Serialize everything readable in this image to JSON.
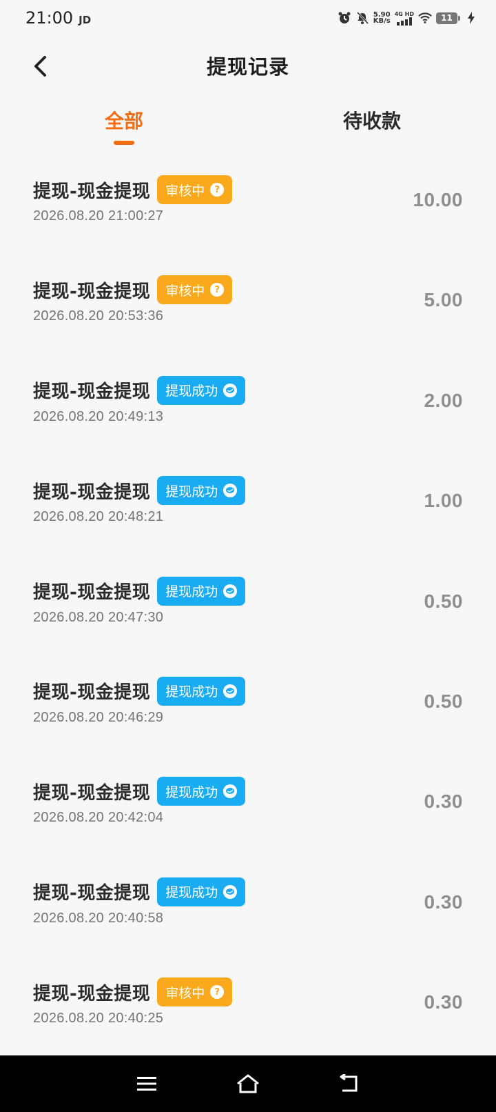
{
  "status_bar": {
    "time": "21:00",
    "carrier": "JD",
    "net_speed_value": "5.90",
    "net_speed_unit": "KB/s",
    "network_label": "4G HD",
    "battery": "11"
  },
  "header": {
    "title": "提现记录"
  },
  "tabs": [
    {
      "label": "全部",
      "active": true
    },
    {
      "label": "待收款",
      "active": false
    }
  ],
  "records": [
    {
      "title": "提现-现金提现",
      "status": "审核中",
      "status_type": "pending",
      "time": "2026.08.20 21:00:27",
      "amount": "10.00"
    },
    {
      "title": "提现-现金提现",
      "status": "审核中",
      "status_type": "pending",
      "time": "2026.08.20 20:53:36",
      "amount": "5.00"
    },
    {
      "title": "提现-现金提现",
      "status": "提现成功",
      "status_type": "success",
      "time": "2026.08.20 20:49:13",
      "amount": "2.00"
    },
    {
      "title": "提现-现金提现",
      "status": "提现成功",
      "status_type": "success",
      "time": "2026.08.20 20:48:21",
      "amount": "1.00"
    },
    {
      "title": "提现-现金提现",
      "status": "提现成功",
      "status_type": "success",
      "time": "2026.08.20 20:47:30",
      "amount": "0.50"
    },
    {
      "title": "提现-现金提现",
      "status": "提现成功",
      "status_type": "success",
      "time": "2026.08.20 20:46:29",
      "amount": "0.50"
    },
    {
      "title": "提现-现金提现",
      "status": "提现成功",
      "status_type": "success",
      "time": "2026.08.20 20:42:04",
      "amount": "0.30"
    },
    {
      "title": "提现-现金提现",
      "status": "提现成功",
      "status_type": "success",
      "time": "2026.08.20 20:40:58",
      "amount": "0.30"
    },
    {
      "title": "提现-现金提现",
      "status": "审核中",
      "status_type": "pending",
      "time": "2026.08.20 20:40:25",
      "amount": "0.30"
    }
  ],
  "colors": {
    "accent": "#f36c12",
    "pending": "#faa81c",
    "success": "#1aacf3"
  },
  "icons": {
    "pending_badge": "question-icon",
    "success_badge": "chat-bubble-icon",
    "nav": [
      "menu-icon",
      "home-icon",
      "back-arrow-icon"
    ]
  }
}
